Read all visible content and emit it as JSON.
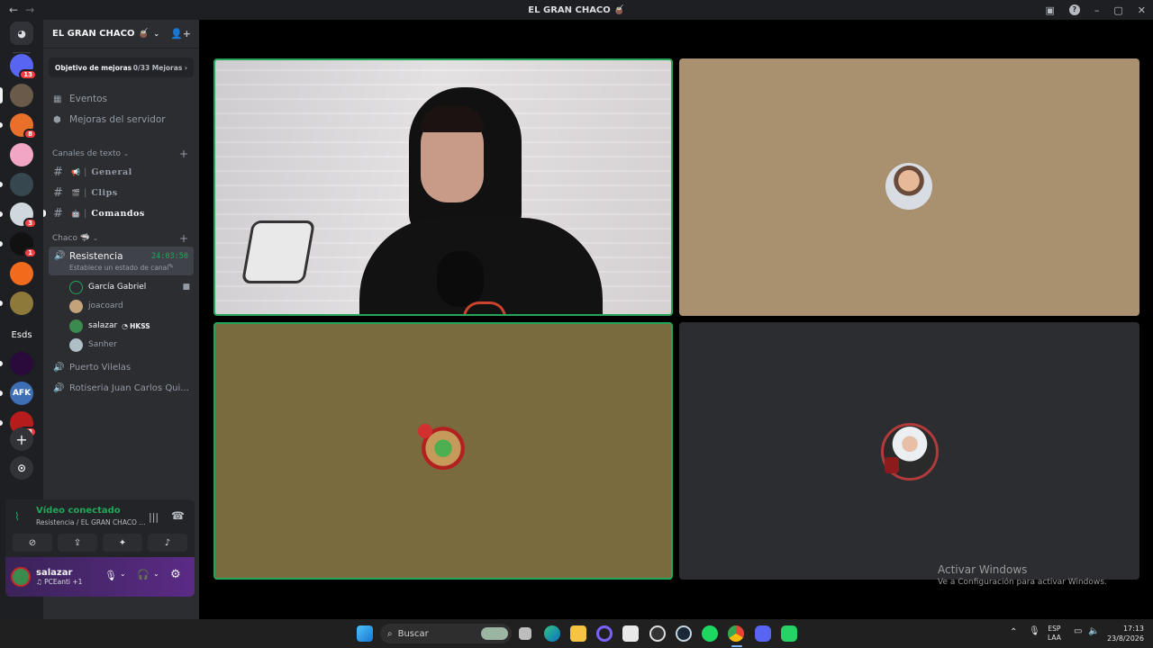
{
  "window": {
    "title": "EL GRAN CHACO 🧉"
  },
  "guilds": [
    {
      "name": "server-1",
      "color": "#5865f2",
      "badge": "13"
    },
    {
      "name": "server-2",
      "color": "#6a5a4a",
      "badge": ""
    },
    {
      "name": "server-3",
      "color": "#e9702a",
      "badge": "8"
    },
    {
      "name": "server-4",
      "color": "#f1a6c6",
      "badge": ""
    },
    {
      "name": "server-5",
      "color": "#37474f",
      "badge": ""
    },
    {
      "name": "server-6",
      "color": "#cfd8dc",
      "badge": "3"
    },
    {
      "name": "server-7",
      "color": "#111111",
      "badge": "1"
    },
    {
      "name": "server-8",
      "color": "#f26b1d",
      "badge": ""
    },
    {
      "name": "server-9",
      "color": "#8d7a3a",
      "badge": ""
    },
    {
      "name": "server-10",
      "color": "#1e1f22",
      "badge": "",
      "text": "Esds"
    },
    {
      "name": "server-11",
      "color": "#2a0a3a",
      "badge": ""
    },
    {
      "name": "server-12",
      "color": "#3e6fb5",
      "badge": "",
      "text": "AFK"
    },
    {
      "name": "server-13",
      "color": "#b71c1c",
      "badge": "63"
    }
  ],
  "server": {
    "name": "EL GRAN CHACO 🧉",
    "boost_label": "Objetivo de mejoras",
    "boost_value": "0/33 Mejoras",
    "events": "Eventos",
    "boosts": "Mejoras del servidor",
    "text_category": "Canales de texto",
    "text_channels": [
      {
        "emoji": "📢",
        "name": "General"
      },
      {
        "emoji": "🎬",
        "name": "Clips"
      },
      {
        "emoji": "🤖",
        "name": "Comandos"
      }
    ],
    "voice_category": "Chaco 🦈",
    "active_voice": {
      "name": "Resistencia",
      "timer": "24:03:50",
      "status": "Establece un estado de canal",
      "members": [
        {
          "name": "García Gabriel",
          "extra": ""
        },
        {
          "name": "joacoard",
          "extra": ""
        },
        {
          "name": "salazar",
          "extra": "HKSS"
        },
        {
          "name": "Sanher",
          "extra": ""
        }
      ]
    },
    "other_voice": [
      "Puerto Vilelas",
      "Rotiseria Juan Carlos Qui..."
    ]
  },
  "voice_panel": {
    "status": "Vídeo conectado",
    "location": "Resistencia / EL GRAN CHACO ..."
  },
  "user": {
    "name": "salazar",
    "activity": "PCEanti +1"
  },
  "watermark": {
    "title": "Activar Windows",
    "subtitle": "Ve a Configuración para activar Windows."
  },
  "taskbar": {
    "search_placeholder": "Buscar",
    "lang": "ESP",
    "lang2": "LAA",
    "time": "17:13",
    "date": "23/8/2026"
  },
  "colors": {
    "tile_tan": "#a9916f",
    "tile_olive": "#7a6b3f",
    "tile_dark": "#2b2d31",
    "speaking_green": "#23a55a"
  }
}
